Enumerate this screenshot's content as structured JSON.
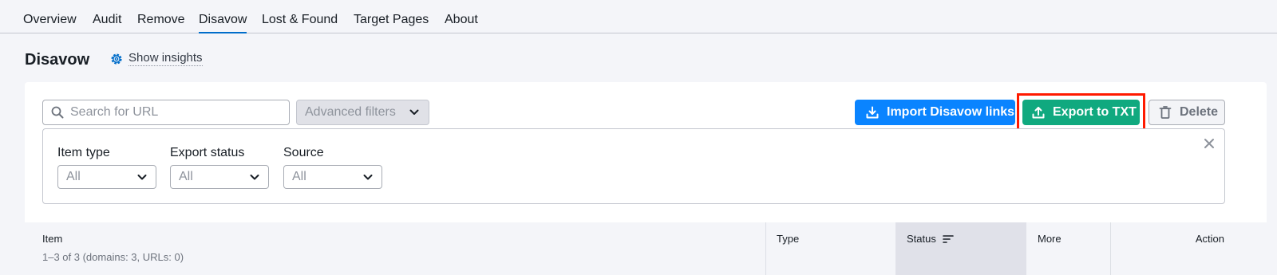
{
  "nav": {
    "tabs": [
      {
        "label": "Overview"
      },
      {
        "label": "Audit"
      },
      {
        "label": "Remove"
      },
      {
        "label": "Disavow",
        "active": true
      },
      {
        "label": "Lost & Found"
      },
      {
        "label": "Target Pages"
      },
      {
        "label": "About"
      }
    ]
  },
  "page": {
    "title": "Disavow",
    "insights_label": "Show insights"
  },
  "toolbar": {
    "search_placeholder": "Search for URL",
    "advanced_filters_label": "Advanced filters",
    "import_label": "Import Disavow links",
    "export_label": "Export to TXT",
    "delete_label": "Delete"
  },
  "filters": {
    "item_type": {
      "label": "Item type",
      "value": "All"
    },
    "export_status": {
      "label": "Export status",
      "value": "All"
    },
    "source": {
      "label": "Source",
      "value": "All"
    }
  },
  "table": {
    "columns": {
      "item": "Item",
      "type": "Type",
      "status": "Status",
      "more": "More",
      "action": "Action"
    },
    "summary": "1–3 of 3 (domains: 3, URLs: 0)"
  },
  "colors": {
    "accent_blue": "#0a84ff",
    "export_green": "#10a97f",
    "highlight_red": "#ff1a00"
  }
}
